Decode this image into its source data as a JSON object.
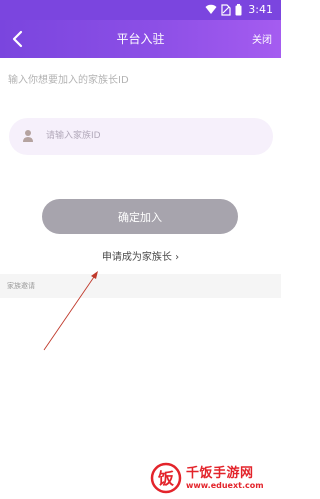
{
  "status_bar": {
    "time": "3:41"
  },
  "header": {
    "title": "平台入驻",
    "close_label": "关闭"
  },
  "form": {
    "hint": "输入你想要加入的家族长ID",
    "id_placeholder": "请输入家族ID",
    "confirm_label": "确定加入",
    "apply_label": "申请成为家族长 ›"
  },
  "section": {
    "label": "家族邀请"
  },
  "watermark": {
    "logo_char": "饭",
    "name": "千饭手游网",
    "url": "www.eduext.com"
  },
  "colors": {
    "header_start": "#7a45de",
    "header_end": "#a55cf0",
    "button_disabled": "#a7a4ad",
    "input_bg": "#f6f0fb",
    "annotation_red": "#c0392b",
    "watermark_red": "#e3242b"
  }
}
